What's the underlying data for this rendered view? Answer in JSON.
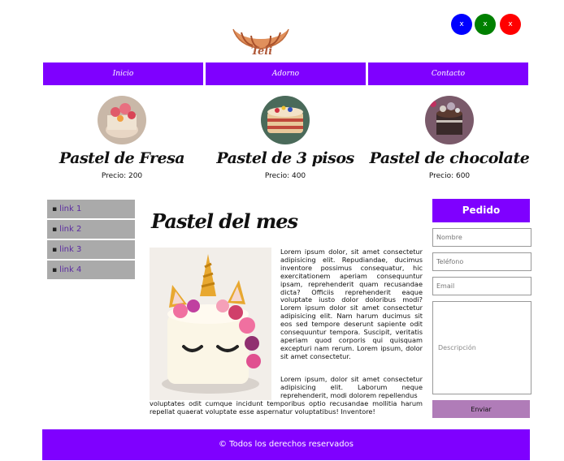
{
  "header": {
    "logo_text": "Teli",
    "buttons": [
      {
        "label": "x",
        "color": "#0000ff"
      },
      {
        "label": "x",
        "color": "#008000"
      },
      {
        "label": "x",
        "color": "#ff0000"
      }
    ]
  },
  "nav": {
    "items": [
      {
        "label": "Inicio"
      },
      {
        "label": "Adorno"
      },
      {
        "label": "Contacto"
      }
    ]
  },
  "products": [
    {
      "name": "Pastel de Fresa",
      "price": "Precio: 200"
    },
    {
      "name": "Pastel de 3 pisos",
      "price": "Precio: 400"
    },
    {
      "name": "Pastel de chocolate",
      "price": "Precio: 600"
    }
  ],
  "sidebar": {
    "links": [
      {
        "label": "link 1"
      },
      {
        "label": "link 2"
      },
      {
        "label": "link 3"
      },
      {
        "label": "link 4"
      }
    ]
  },
  "main": {
    "title": "Pastel del mes",
    "paragraph1": "Lorem ipsum dolor, sit amet consectetur adipisicing elit. Repudiandae, ducimus inventore possimus consequatur, hic exercitationem aperiam consequuntur ipsam, reprehenderit quam recusandae dicta? Officiis reprehenderit eaque voluptate iusto dolor doloribus modi? Lorem ipsum dolor sit amet consectetur adipisicing elit. Nam harum ducimus sit eos sed tempore deserunt sapiente odit consequuntur tempora. Suscipit, veritatis aperiam quod corporis qui quisquam excepturi nam rerum. Lorem ipsum, dolor sit amet consectetur.",
    "paragraph2_a": "Lorem ipsum, dolor sit amet consectetur adipisicing elit. Laborum neque reprehenderit, modi dolorem repellendus",
    "paragraph2_b": "voluptates odit cumque incidunt temporibus optio recusandae mollitia harum repellat quaerat voluptate esse aspernatur voluptatibus! Inventore!"
  },
  "form": {
    "title": "Pedido",
    "name_placeholder": "Nombre",
    "phone_placeholder": "Teléfono",
    "email_placeholder": "Email",
    "description_placeholder": "Descripción",
    "submit_label": "Enviar"
  },
  "footer": {
    "text": "© Todos los derechos reservados"
  },
  "colors": {
    "accent": "#7f00ff",
    "sidebar_bg": "#aaaaaa",
    "submit_bg": "#b07cb8"
  }
}
